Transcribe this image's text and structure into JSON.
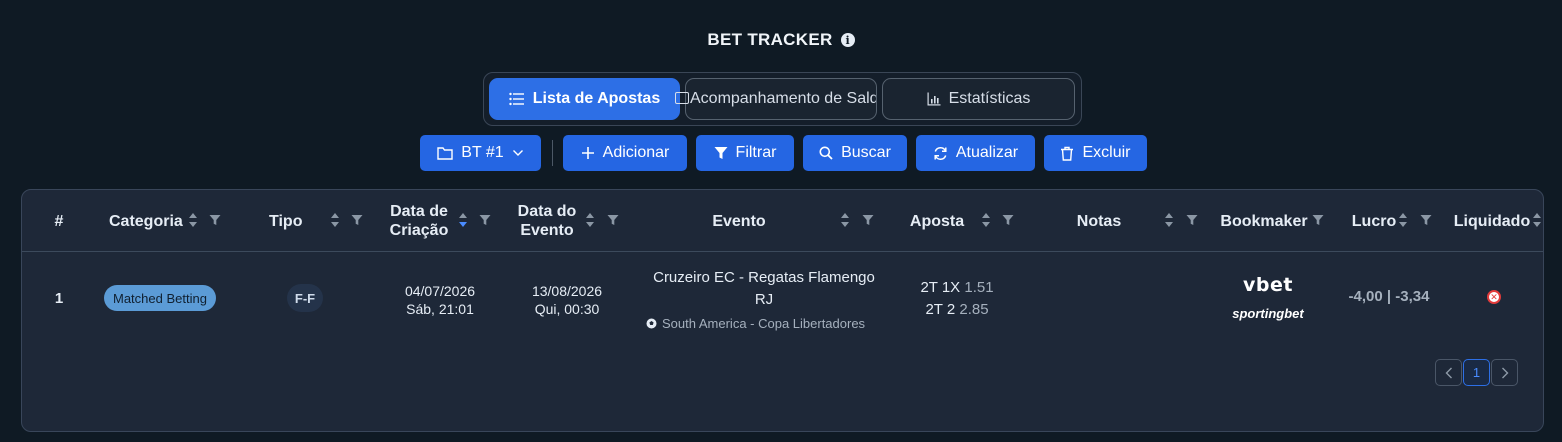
{
  "header": {
    "title": "BET TRACKER",
    "info_icon": "info-icon"
  },
  "tabs": [
    {
      "label": "Lista de Apostas",
      "icon": "list-icon",
      "active": true
    },
    {
      "label": "Acompanhamento de Saldo",
      "icon": "wallet-icon",
      "active": false
    },
    {
      "label": "Estatísticas",
      "icon": "bar-chart-icon",
      "active": false
    }
  ],
  "toolbar": {
    "tracker_label": "BT #1",
    "add_label": "Adicionar",
    "filter_label": "Filtrar",
    "search_label": "Buscar",
    "refresh_label": "Atualizar",
    "delete_label": "Excluir"
  },
  "table": {
    "columns": {
      "num": "#",
      "categoria": "Categoria",
      "tipo": "Tipo",
      "data_criacao_1": "Data de",
      "data_criacao_2": "Criação",
      "data_evento_1": "Data do",
      "data_evento_2": "Evento",
      "evento": "Evento",
      "aposta": "Aposta",
      "notas": "Notas",
      "bookmaker": "Bookmaker",
      "lucro": "Lucro",
      "liquidado": "Liquidado"
    },
    "rows": [
      {
        "num": "1",
        "categoria": "Matched Betting",
        "tipo": "F-F",
        "data_criacao_date": "04/07/2026",
        "data_criacao_time": "Sáb, 21:01",
        "data_evento_date": "13/08/2026",
        "data_evento_time": "Qui, 00:30",
        "evento_line1": "Cruzeiro EC - Regatas Flamengo",
        "evento_line2": "RJ",
        "evento_league": "South America - Copa Libertadores",
        "aposta1_market": "2T 1X",
        "aposta1_odd": "1.51",
        "aposta2_market": "2T 2",
        "aposta2_odd": "2.85",
        "bookmaker1": "vbet",
        "bookmaker2": "sportingbet",
        "lucro": "-4,00 | -3,34",
        "liquidado_icon": "x-circle-icon"
      }
    ]
  },
  "pagination": {
    "current": "1",
    "prev_icon": "chevron-left-icon",
    "next_icon": "chevron-right-icon"
  },
  "colors": {
    "accent": "#2566e3",
    "background": "#0f1a24",
    "card": "#1e2838",
    "badge": "#5b9bd6",
    "danger": "#e23b3b"
  }
}
